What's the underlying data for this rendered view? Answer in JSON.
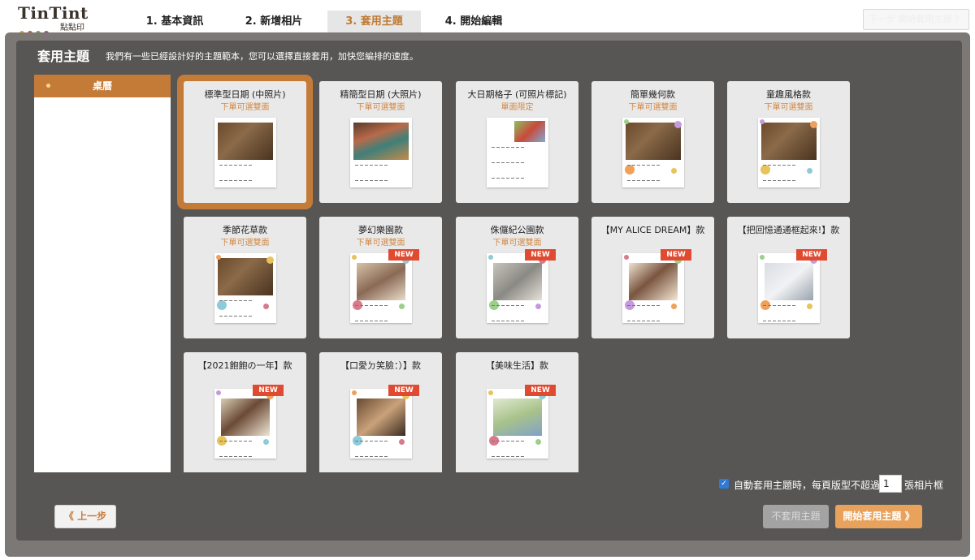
{
  "brand": {
    "name": "TinTint",
    "subtitle": "點點印",
    "dot_colors": [
      "#d4a436",
      "#c9513a",
      "#8a9a48",
      "#9c4f7a",
      "#d98a3c"
    ]
  },
  "steps": [
    {
      "label": "1. 基本資訊"
    },
    {
      "label": "2. 新增相片"
    },
    {
      "label": "3. 套用主題",
      "active": true
    },
    {
      "label": "4. 開始編輯"
    }
  ],
  "next_button": {
    "label": "下一步 開始套用主題 》"
  },
  "header": {
    "title": "套用主題",
    "description": "我們有一些已經設計好的主題範本，您可以選擇直接套用，加快您編排的速度。"
  },
  "categories": [
    {
      "label": "桌曆",
      "selected": true
    }
  ],
  "themes": [
    {
      "name": "標準型日期 (中照片)",
      "note": "下單可選雙面",
      "selected": true,
      "new": false,
      "photo": "coffee"
    },
    {
      "name": "精簡型日期 (大照片)",
      "note": "下單可選雙面",
      "new": false,
      "photo": "mural"
    },
    {
      "name": "大日期格子 (可照片標記)",
      "note": "單面限定",
      "new": false,
      "photo": "flower"
    },
    {
      "name": "簡單幾何款",
      "note": "下單可選雙面",
      "new": false,
      "photo": "coffee"
    },
    {
      "name": "童趣風格款",
      "note": "下單可選雙面",
      "new": false,
      "photo": "coffee"
    },
    {
      "name": "季節花草款",
      "note": "下單可選雙面",
      "new": false,
      "photo": "coffee"
    },
    {
      "name": "夢幻樂園款",
      "note": "下單可選雙面",
      "new": true,
      "photo": "baby"
    },
    {
      "name": "侏儸紀公園款",
      "note": "下單可選雙面",
      "new": true,
      "photo": "cat"
    },
    {
      "name": "【MY ALICE DREAM】款",
      "note": "",
      "new": true,
      "photo": "woman"
    },
    {
      "name": "【把回憶通通框起來!】款",
      "note": "",
      "new": true,
      "photo": "whitecat"
    },
    {
      "name": "【2021飽飽の一年】款",
      "note": "",
      "new": true,
      "photo": "child"
    },
    {
      "name": "【口愛ㄉ笑臉：）】款",
      "note": "",
      "new": true,
      "photo": "dog"
    },
    {
      "name": "【美味生活】款",
      "note": "",
      "new": true,
      "photo": "girl"
    }
  ],
  "badge_label": "NEW",
  "bottom": {
    "auto_apply_checked": true,
    "auto_apply_text": "自動套用主題時，每頁版型不超過",
    "frames_value": "1",
    "frames_suffix": "張相片框",
    "prev_label": "《 上一步",
    "no_apply_label": "不套用主題",
    "start_apply_label": "開始套用主題 》"
  },
  "colors": {
    "accent": "#c57b38",
    "new_badge": "#e04a30",
    "start_button": "#e8a25c"
  }
}
